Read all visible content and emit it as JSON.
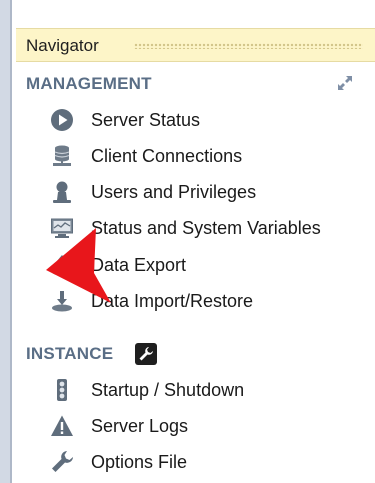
{
  "navigator": {
    "title": "Navigator",
    "sections": [
      {
        "label": "MANAGEMENT",
        "items": [
          {
            "label": "Server Status",
            "icon": "play-circle-icon"
          },
          {
            "label": "Client Connections",
            "icon": "database-icon"
          },
          {
            "label": "Users and Privileges",
            "icon": "user-icon"
          },
          {
            "label": "Status and System Variables",
            "icon": "monitor-icon"
          },
          {
            "label": "Data Export",
            "icon": "export-icon"
          },
          {
            "label": "Data Import/Restore",
            "icon": "import-icon"
          }
        ]
      },
      {
        "label": "INSTANCE",
        "items": [
          {
            "label": "Startup / Shutdown",
            "icon": "traffic-light-icon"
          },
          {
            "label": "Server Logs",
            "icon": "warning-icon"
          },
          {
            "label": "Options File",
            "icon": "wrench-icon"
          }
        ]
      }
    ]
  },
  "colors": {
    "header_bg": "#fdf5c8",
    "section_text": "#5a6e86",
    "annotation_arrow": "#e8161b"
  }
}
